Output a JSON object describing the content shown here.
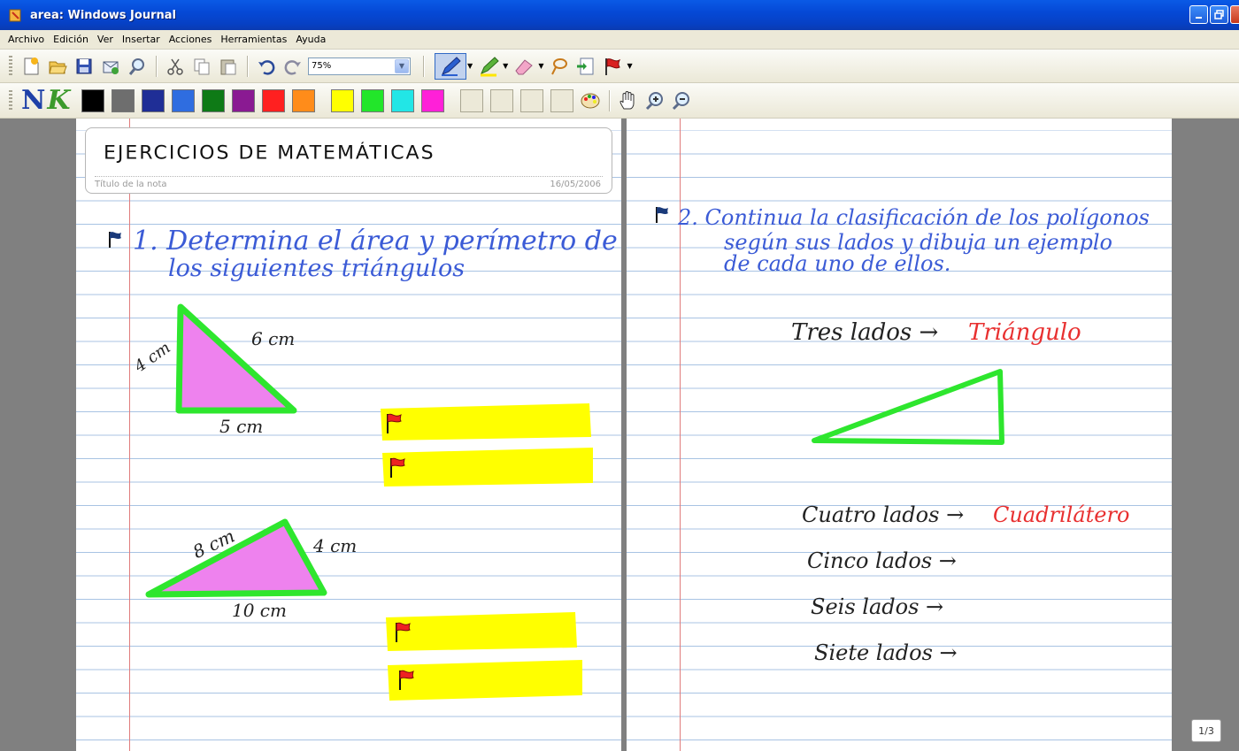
{
  "window": {
    "title": "area: Windows Journal"
  },
  "menu": [
    "Archivo",
    "Edición",
    "Ver",
    "Insertar",
    "Acciones",
    "Herramientas",
    "Ayuda"
  ],
  "toolbar": {
    "zoom_value": "75%",
    "colors": [
      "#000000",
      "#6e6e6e",
      "#1f2e96",
      "#2f6de0",
      "#0e7a16",
      "#8a1a92",
      "#ff2020",
      "#ff8c1a",
      "#ffff00",
      "#22e62a",
      "#22e6e6",
      "#ff20d8"
    ],
    "empty_slots": 4
  },
  "note": {
    "title": "EJERCICIOS DE MATEMÁTICAS",
    "title_label": "Título de la nota",
    "date": "16/05/2006",
    "left": {
      "exercise1_line1": "1. Determina el área y perímetro de",
      "exercise1_line2": "los siguientes triángulos",
      "tri1_side_a": "4 cm",
      "tri1_side_b": "6 cm",
      "tri1_side_c": "5 cm",
      "tri2_side_a": "8 cm",
      "tri2_side_b": "4 cm",
      "tri2_side_c": "10 cm"
    },
    "right": {
      "exercise2_line1": "2. Continua la clasificación de los polígonos",
      "exercise2_line2": "según sus lados y dibuja un ejemplo",
      "exercise2_line3": "de cada uno de ellos.",
      "row1_label": "Tres lados →",
      "row1_answer": "Triángulo",
      "row2_label": "Cuatro lados →",
      "row2_answer": "Cuadrilátero",
      "row3_label": "Cinco lados →",
      "row4_label": "Seis lados →",
      "row5_label": "Siete lados →"
    }
  },
  "status": {
    "page_indicator": "1/3"
  }
}
